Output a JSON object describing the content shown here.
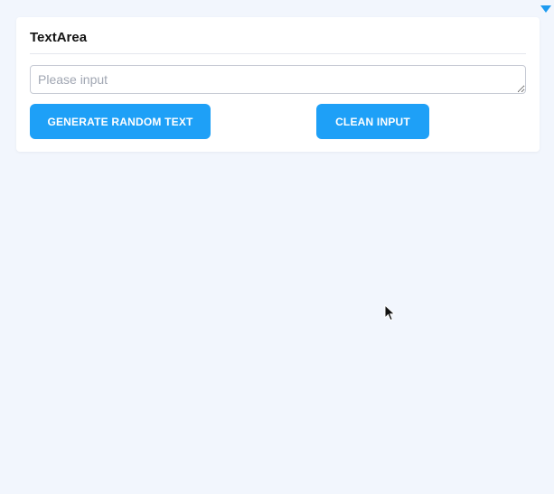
{
  "card": {
    "title": "TextArea"
  },
  "textarea": {
    "value": "",
    "placeholder": "Please input"
  },
  "buttons": {
    "generate_label": "GENERATE RANDOM TEXT",
    "clean_label": "CLEAN INPUT"
  },
  "colors": {
    "accent": "#1ea0f7",
    "page_background": "#f2f6fd",
    "card_background": "#ffffff"
  },
  "icons": {
    "corner": "caret-down-icon",
    "pointer": "mouse-cursor-icon"
  }
}
